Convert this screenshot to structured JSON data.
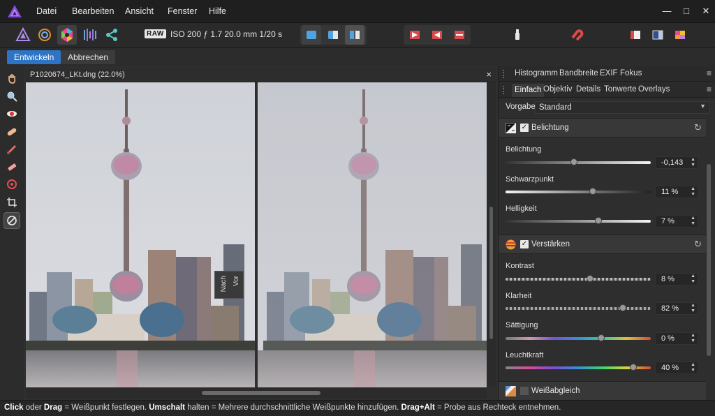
{
  "menu": {
    "items": [
      "Datei",
      "Bearbeiten",
      "Ansicht",
      "Fenster",
      "Hilfe"
    ]
  },
  "toolbar": {
    "raw_badge": "RAW",
    "exif": "ISO 200 ƒ 1.7 20.0 mm 1/20 s"
  },
  "actions": {
    "develop": "Entwickeln",
    "cancel": "Abbrechen"
  },
  "document": {
    "title": "P1020674_LKt.dng (22.0%)",
    "close": "×",
    "split_after": "Nach",
    "split_before": "Vor"
  },
  "panel": {
    "top_tabs": [
      "Histogramm",
      "Bandbreite",
      "EXIF",
      "Fokus"
    ],
    "sub_tabs": [
      "Einfach",
      "Objektiv",
      "Details",
      "Tonwerte",
      "Overlays"
    ],
    "preset_label": "Vorgabe:",
    "preset_value": "Standard",
    "sections": {
      "exposure": {
        "label": "Belichtung",
        "enabled": true,
        "sliders": [
          {
            "label": "Belichtung",
            "value": "-0,143",
            "position": 0.47
          },
          {
            "label": "Schwarzpunkt",
            "value": "11 %",
            "position": 0.6
          },
          {
            "label": "Helligkeit",
            "value": "7 %",
            "position": 0.64
          }
        ]
      },
      "enhance": {
        "label": "Verstärken",
        "enabled": true,
        "sliders": [
          {
            "label": "Kontrast",
            "value": "8 %",
            "position": 0.58
          },
          {
            "label": "Klarheit",
            "value": "82 %",
            "position": 0.81
          },
          {
            "label": "Sättigung",
            "value": "0 %",
            "position": 0.66
          },
          {
            "label": "Leuchtkraft",
            "value": "40 %",
            "position": 0.88
          }
        ]
      },
      "white_balance": {
        "label": "Weißabgleich",
        "enabled": false
      }
    }
  },
  "status": {
    "click": "Click",
    "or": " oder ",
    "drag": "Drag",
    "part1": " = Weißpunkt festlegen. ",
    "shift": "Umschalt",
    "part2": " halten = Mehrere durchschnittliche Weißpunkte hinzufügen. ",
    "dragalt": "Drag+Alt",
    "part3": " = Probe aus Rechteck entnehmen."
  },
  "colors": {
    "accent": "#2e74c4",
    "background": "#2f2f2f"
  }
}
